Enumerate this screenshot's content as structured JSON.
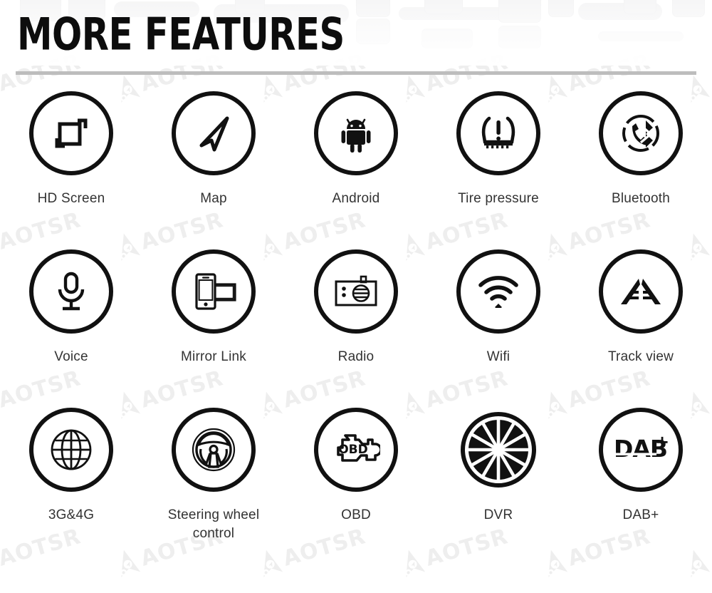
{
  "header": {
    "title": "MORE FEATURES",
    "divider_color": "#bdbdbd"
  },
  "watermark": {
    "text": "AOTSR",
    "color": "#eeeeee"
  },
  "colors": {
    "icon_stroke": "#111111",
    "label_text": "#333333",
    "background": "#ffffff"
  },
  "features": [
    {
      "label": "HD Screen",
      "icon": "hd-screen-icon"
    },
    {
      "label": "Map",
      "icon": "navigation-arrow-icon"
    },
    {
      "label": "Android",
      "icon": "android-robot-icon"
    },
    {
      "label": "Tire pressure",
      "icon": "tire-pressure-warning-icon"
    },
    {
      "label": "Bluetooth",
      "icon": "bluetooth-phone-icon"
    },
    {
      "label": "Voice",
      "icon": "microphone-icon"
    },
    {
      "label": "Mirror Link",
      "icon": "phone-screen-mirror-icon"
    },
    {
      "label": "Radio",
      "icon": "radio-icon"
    },
    {
      "label": "Wifi",
      "icon": "wifi-icon"
    },
    {
      "label": "Track view",
      "icon": "track-view-icon"
    },
    {
      "label": "3G&4G",
      "icon": "globe-icon"
    },
    {
      "label": "Steering wheel control",
      "icon": "steering-wheel-icon"
    },
    {
      "label": "OBD",
      "icon": "obd-engine-icon"
    },
    {
      "label": "DVR",
      "icon": "camera-shutter-icon"
    },
    {
      "label": "DAB+",
      "icon": "dab-plus-icon"
    }
  ]
}
